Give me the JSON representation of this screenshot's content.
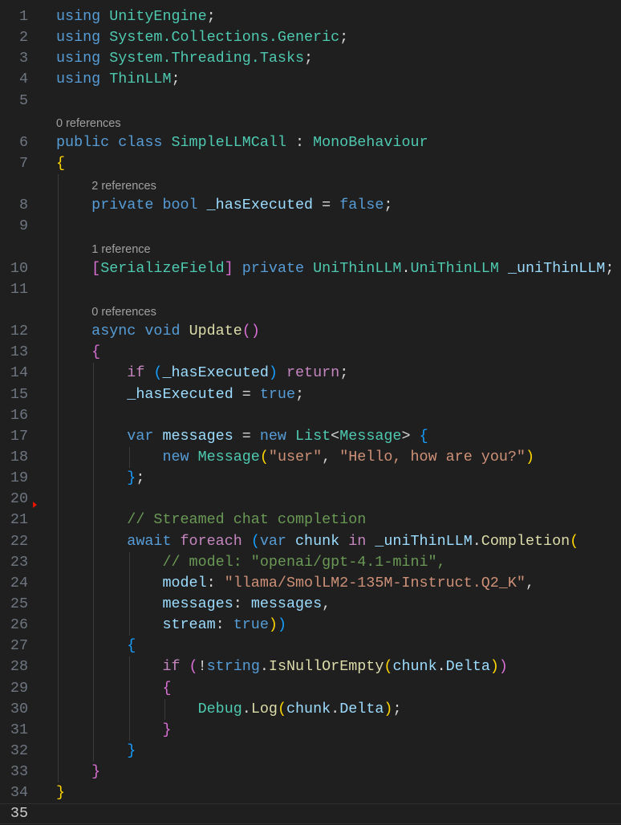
{
  "editor": {
    "lines": [
      {
        "n": 1,
        "tokens": [
          [
            "using",
            "k"
          ],
          [
            " UnityEngine",
            "t"
          ],
          [
            ";",
            "p"
          ]
        ]
      },
      {
        "n": 2,
        "tokens": [
          [
            "using",
            "k"
          ],
          [
            " System.Collections.Generic",
            "t"
          ],
          [
            ";",
            "p"
          ]
        ]
      },
      {
        "n": 3,
        "tokens": [
          [
            "using",
            "k"
          ],
          [
            " System.Threading.Tasks",
            "t"
          ],
          [
            ";",
            "p"
          ]
        ]
      },
      {
        "n": 4,
        "tokens": [
          [
            "using",
            "k"
          ],
          [
            " ThinLLM",
            "t"
          ],
          [
            ";",
            "p"
          ]
        ]
      },
      {
        "n": 5,
        "tokens": []
      },
      {
        "lens": "0 references",
        "indent": 0
      },
      {
        "n": 6,
        "tokens": [
          [
            "public class ",
            "k"
          ],
          [
            "SimpleLLMCall",
            "t"
          ],
          [
            " : ",
            "p"
          ],
          [
            "MonoBehaviour",
            "t"
          ]
        ]
      },
      {
        "n": 7,
        "tokens": [
          [
            "{",
            "b1"
          ]
        ]
      },
      {
        "lens": "2 references",
        "indent": 1
      },
      {
        "n": 8,
        "tokens": [
          [
            "    ",
            "p"
          ],
          [
            "private bool ",
            "k"
          ],
          [
            "_hasExecuted",
            "v"
          ],
          [
            " = ",
            "p"
          ],
          [
            "false",
            "k"
          ],
          [
            ";",
            "p"
          ]
        ]
      },
      {
        "n": 9,
        "tokens": [
          [
            "    ",
            "p"
          ]
        ]
      },
      {
        "lens": "1 reference",
        "indent": 1
      },
      {
        "n": 10,
        "tokens": [
          [
            "    ",
            "p"
          ],
          [
            "[",
            "b2"
          ],
          [
            "SerializeField",
            "t"
          ],
          [
            "]",
            "b2"
          ],
          [
            " private ",
            "k"
          ],
          [
            "UniThinLLM",
            "t"
          ],
          [
            ".",
            "p"
          ],
          [
            "UniThinLLM",
            "t"
          ],
          [
            " ",
            "p"
          ],
          [
            "_uniThinLLM",
            "v"
          ],
          [
            ";",
            "p"
          ]
        ]
      },
      {
        "n": 11,
        "tokens": [
          [
            "    ",
            "p"
          ]
        ]
      },
      {
        "lens": "0 references",
        "indent": 1
      },
      {
        "n": 12,
        "tokens": [
          [
            "    ",
            "p"
          ],
          [
            "async void ",
            "k"
          ],
          [
            "Update",
            "f"
          ],
          [
            "()",
            "b2"
          ]
        ]
      },
      {
        "n": 13,
        "tokens": [
          [
            "    ",
            "p"
          ],
          [
            "{",
            "b2"
          ]
        ]
      },
      {
        "n": 14,
        "tokens": [
          [
            "        ",
            "p"
          ],
          [
            "if ",
            "c"
          ],
          [
            "(",
            "b3"
          ],
          [
            "_hasExecuted",
            "v"
          ],
          [
            ")",
            "b3"
          ],
          [
            " return",
            "c"
          ],
          [
            ";",
            "p"
          ]
        ]
      },
      {
        "n": 15,
        "tokens": [
          [
            "        ",
            "p"
          ],
          [
            "_hasExecuted",
            "v"
          ],
          [
            " = ",
            "p"
          ],
          [
            "true",
            "k"
          ],
          [
            ";",
            "p"
          ]
        ]
      },
      {
        "n": 16,
        "tokens": [
          [
            "        ",
            "p"
          ]
        ]
      },
      {
        "n": 17,
        "tokens": [
          [
            "        ",
            "p"
          ],
          [
            "var ",
            "k"
          ],
          [
            "messages",
            "v"
          ],
          [
            " = ",
            "p"
          ],
          [
            "new ",
            "k"
          ],
          [
            "List",
            "t"
          ],
          [
            "<",
            "p"
          ],
          [
            "Message",
            "t"
          ],
          [
            "> ",
            "p"
          ],
          [
            "{",
            "b3"
          ]
        ]
      },
      {
        "n": 18,
        "tokens": [
          [
            "            ",
            "p"
          ],
          [
            "new ",
            "k"
          ],
          [
            "Message",
            "t"
          ],
          [
            "(",
            "b1"
          ],
          [
            "\"user\"",
            "s"
          ],
          [
            ", ",
            "p"
          ],
          [
            "\"Hello, how are you?\"",
            "s"
          ],
          [
            ")",
            "b1"
          ]
        ]
      },
      {
        "n": 19,
        "tokens": [
          [
            "        ",
            "p"
          ],
          [
            "}",
            "b3"
          ],
          [
            ";",
            "p"
          ]
        ]
      },
      {
        "n": 20,
        "tokens": [
          [
            "        ",
            "p"
          ]
        ]
      },
      {
        "n": 21,
        "tokens": [
          [
            "        ",
            "p"
          ],
          [
            "// Streamed chat completion",
            "m"
          ]
        ]
      },
      {
        "n": 22,
        "tokens": [
          [
            "        ",
            "p"
          ],
          [
            "await ",
            "k"
          ],
          [
            "foreach ",
            "c"
          ],
          [
            "(",
            "b3"
          ],
          [
            "var ",
            "k"
          ],
          [
            "chunk ",
            "v"
          ],
          [
            "in ",
            "c"
          ],
          [
            "_uniThinLLM",
            "v"
          ],
          [
            ".",
            "p"
          ],
          [
            "Completion",
            "f"
          ],
          [
            "(",
            "b1"
          ]
        ]
      },
      {
        "n": 23,
        "tokens": [
          [
            "            ",
            "p"
          ],
          [
            "// model: \"openai/gpt-4.1-mini\",",
            "m"
          ]
        ]
      },
      {
        "n": 24,
        "tokens": [
          [
            "            ",
            "p"
          ],
          [
            "model",
            "v"
          ],
          [
            ": ",
            "p"
          ],
          [
            "\"llama/SmolLM2-135M-Instruct.Q2_K\"",
            "s"
          ],
          [
            ",",
            "p"
          ]
        ]
      },
      {
        "n": 25,
        "tokens": [
          [
            "            ",
            "p"
          ],
          [
            "messages",
            "v"
          ],
          [
            ": ",
            "p"
          ],
          [
            "messages",
            "v"
          ],
          [
            ",",
            "p"
          ]
        ]
      },
      {
        "n": 26,
        "tokens": [
          [
            "            ",
            "p"
          ],
          [
            "stream",
            "v"
          ],
          [
            ": ",
            "p"
          ],
          [
            "true",
            "k"
          ],
          [
            ")",
            "b1"
          ],
          [
            ")",
            "b3"
          ]
        ]
      },
      {
        "n": 27,
        "tokens": [
          [
            "        ",
            "p"
          ],
          [
            "{",
            "b3"
          ]
        ]
      },
      {
        "n": 28,
        "tokens": [
          [
            "            ",
            "p"
          ],
          [
            "if ",
            "c"
          ],
          [
            "(",
            "b2"
          ],
          [
            "!",
            "p"
          ],
          [
            "string",
            "k"
          ],
          [
            ".",
            "p"
          ],
          [
            "IsNullOrEmpty",
            "f"
          ],
          [
            "(",
            "b1"
          ],
          [
            "chunk",
            "v"
          ],
          [
            ".",
            "p"
          ],
          [
            "Delta",
            "v"
          ],
          [
            ")",
            "b1"
          ],
          [
            ")",
            "b2"
          ]
        ]
      },
      {
        "n": 29,
        "tokens": [
          [
            "            ",
            "p"
          ],
          [
            "{",
            "b2"
          ]
        ]
      },
      {
        "n": 30,
        "tokens": [
          [
            "                ",
            "p"
          ],
          [
            "Debug",
            "t"
          ],
          [
            ".",
            "p"
          ],
          [
            "Log",
            "f"
          ],
          [
            "(",
            "b1"
          ],
          [
            "chunk",
            "v"
          ],
          [
            ".",
            "p"
          ],
          [
            "Delta",
            "v"
          ],
          [
            ")",
            "b1"
          ],
          [
            ";",
            "p"
          ]
        ]
      },
      {
        "n": 31,
        "tokens": [
          [
            "            ",
            "p"
          ],
          [
            "}",
            "b2"
          ]
        ]
      },
      {
        "n": 32,
        "tokens": [
          [
            "        ",
            "p"
          ],
          [
            "}",
            "b3"
          ]
        ]
      },
      {
        "n": 33,
        "tokens": [
          [
            "    ",
            "p"
          ],
          [
            "}",
            "b2"
          ]
        ]
      },
      {
        "n": 34,
        "tokens": [
          [
            "}",
            "b1"
          ]
        ]
      },
      {
        "n": 35,
        "tokens": [],
        "current": true
      }
    ],
    "colors": {
      "background": "#1f1f1f",
      "keyword": "#569cd6",
      "control": "#c586c0",
      "type": "#4ec9b0",
      "variable": "#9cdcfe",
      "function": "#dcdcaa",
      "string": "#ce9178",
      "comment": "#6a9955"
    }
  }
}
